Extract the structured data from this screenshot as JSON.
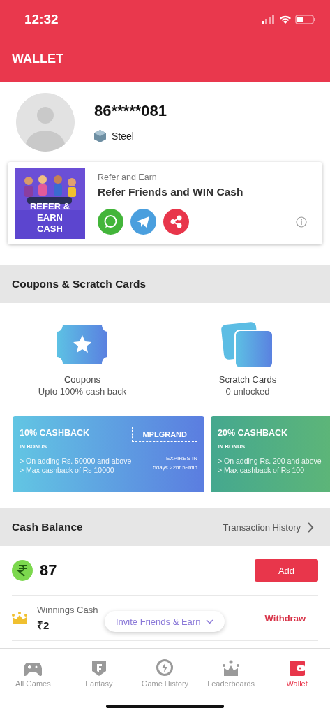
{
  "status_bar": {
    "time": "12:32"
  },
  "header": {
    "title": "WALLET"
  },
  "profile": {
    "phone": "86*****081",
    "tier": "Steel"
  },
  "refer_card": {
    "banner": "REFER & EARN CASH",
    "subtitle": "Refer and Earn",
    "title": "Refer Friends and WIN Cash"
  },
  "coupons_section": {
    "title": "Coupons & Scratch Cards",
    "items": [
      {
        "title": "Coupons",
        "subtitle": "Upto 100% cash back"
      },
      {
        "title": "Scratch Cards",
        "subtitle": "0 unlocked"
      }
    ],
    "offers": [
      {
        "title": "10% CASHBACK",
        "tag": "IN BONUS",
        "lines": [
          "> On adding  Rs. 50000 and above",
          "> Max cashback of Rs 10000"
        ],
        "code": "MPLGRAND",
        "expiry_label": "EXPIRES IN",
        "expiry": "5days 22hr 59min"
      },
      {
        "title": "20% CASHBACK",
        "tag": "IN BONUS",
        "lines": [
          "> On adding  Rs. 200 and above",
          "> Max cashback of Rs 100"
        ]
      }
    ]
  },
  "cash_balance": {
    "title": "Cash Balance",
    "link": "Transaction History",
    "total": "87",
    "add": "Add",
    "winnings_label": "Winnings Cash",
    "winnings": "₹2",
    "withdraw": "Withdraw"
  },
  "invite": {
    "label": "Invite Friends & Earn"
  },
  "tabs": [
    {
      "label": "All Games",
      "selected": false
    },
    {
      "label": "Fantasy",
      "selected": false
    },
    {
      "label": "Game History",
      "selected": false
    },
    {
      "label": "Leaderboards",
      "selected": false
    },
    {
      "label": "Wallet",
      "selected": true
    }
  ]
}
